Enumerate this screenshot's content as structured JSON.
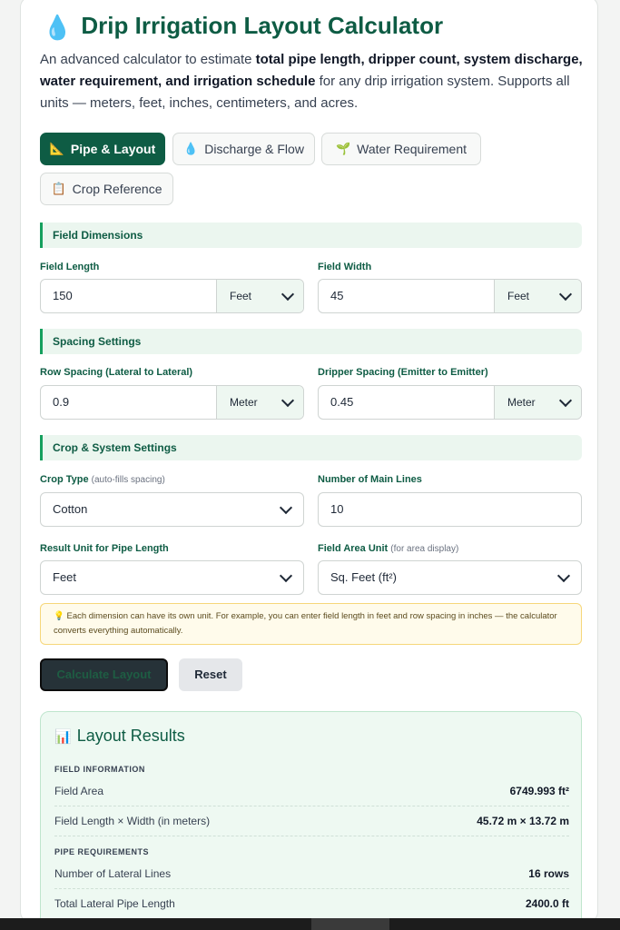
{
  "header": {
    "icon": "💧",
    "title": "Drip Irrigation Layout Calculator",
    "intro_pre": "An advanced calculator to estimate ",
    "intro_bold1": "total pipe length, dripper count, system discharge, water requirement, and irrigation schedule",
    "intro_post": " for any drip irrigation system. Supports all units — meters, feet, inches, centimeters, and acres."
  },
  "tabs": [
    {
      "icon": "📐",
      "label": "Pipe & Layout",
      "active": true
    },
    {
      "icon": "💧",
      "label": "Discharge & Flow",
      "active": false
    },
    {
      "icon": "🌱",
      "label": "Water Requirement",
      "active": false
    },
    {
      "icon": "📋",
      "label": "Crop Reference",
      "active": false
    }
  ],
  "sections": {
    "field_dimensions": "Field Dimensions",
    "spacing_settings": "Spacing Settings",
    "crop_system": "Crop & System Settings"
  },
  "fields": {
    "field_length": {
      "label": "Field Length",
      "value": "150",
      "unit": "Feet"
    },
    "field_width": {
      "label": "Field Width",
      "value": "45",
      "unit": "Feet"
    },
    "row_spacing": {
      "label": "Row Spacing (Lateral to Lateral)",
      "value": "0.9",
      "unit": "Meter"
    },
    "dripper_spacing": {
      "label": "Dripper Spacing (Emitter to Emitter)",
      "value": "0.45",
      "unit": "Meter"
    },
    "crop_type": {
      "label": "Crop Type",
      "hint": "(auto-fills spacing)",
      "value": "Cotton"
    },
    "main_lines": {
      "label": "Number of Main Lines",
      "value": "10"
    },
    "result_unit": {
      "label": "Result Unit for Pipe Length",
      "value": "Feet"
    },
    "area_unit": {
      "label": "Field Area Unit",
      "hint": "(for area display)",
      "value": "Sq. Feet (ft²)"
    }
  },
  "tip": {
    "icon": "💡",
    "text": "Each dimension can have its own unit. For example, you can enter field length in feet and row spacing in inches — the calculator converts everything automatically."
  },
  "buttons": {
    "calculate": "Calculate Layout",
    "reset": "Reset"
  },
  "results": {
    "icon": "📊",
    "title": "Layout Results",
    "field_info_heading": "FIELD INFORMATION",
    "pipe_heading": "PIPE REQUIREMENTS",
    "rows": [
      {
        "key": "Field Area",
        "value": "6749.993 ft²"
      },
      {
        "key": "Field Length × Width (in meters)",
        "value": "45.72 m × 13.72 m"
      },
      {
        "key": "Number of Lateral Lines",
        "value": "16 rows"
      },
      {
        "key": "Total Lateral Pipe Length",
        "value": "2400.0 ft"
      }
    ]
  }
}
